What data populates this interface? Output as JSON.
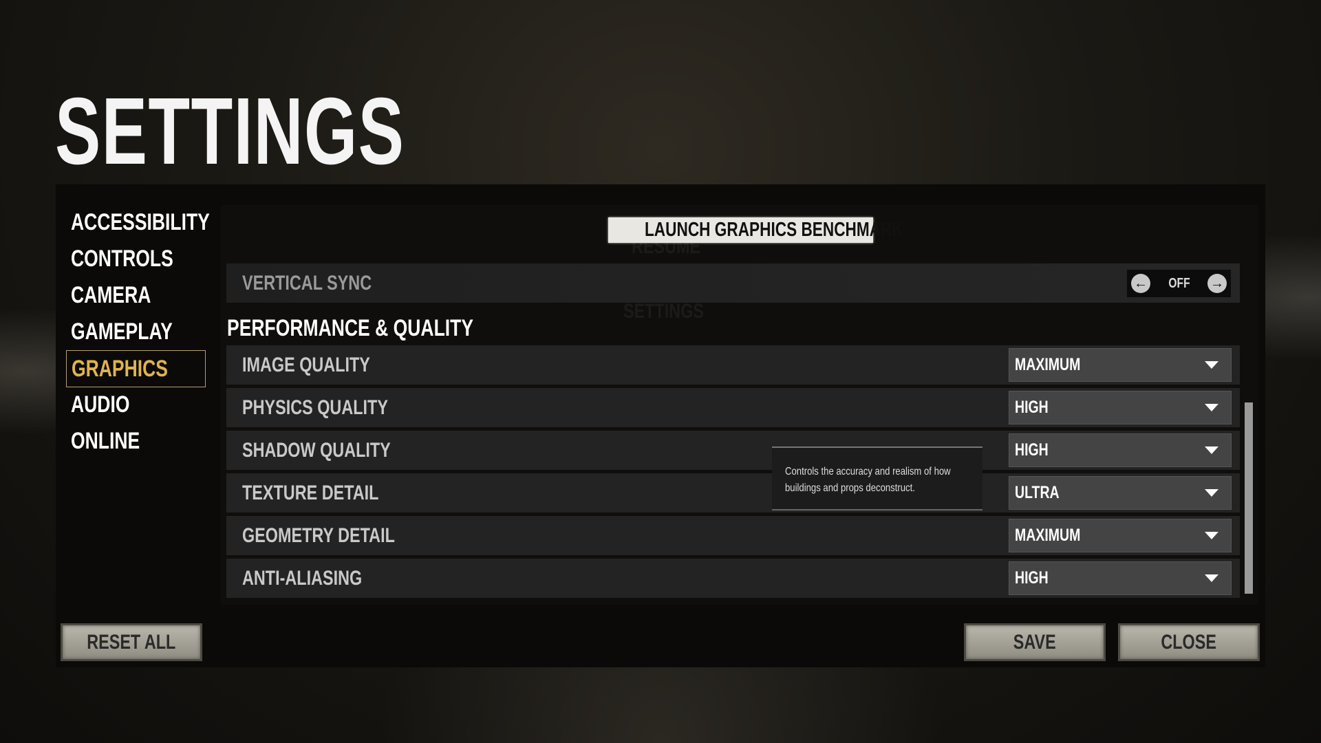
{
  "title": "SETTINGS",
  "sidebar": {
    "items": [
      {
        "label": "ACCESSIBILITY"
      },
      {
        "label": "CONTROLS"
      },
      {
        "label": "CAMERA"
      },
      {
        "label": "GAMEPLAY"
      },
      {
        "label": "GRAPHICS",
        "active": true
      },
      {
        "label": "AUDIO"
      },
      {
        "label": "ONLINE"
      }
    ]
  },
  "ghost": {
    "resume": "RESUME",
    "settings": "SETTINGS"
  },
  "benchmark_label": "LAUNCH GRAPHICS BENCHMARK",
  "vertical_sync": {
    "label": "VERTICAL SYNC",
    "value": "OFF"
  },
  "section_title": "PERFORMANCE & QUALITY",
  "settings": [
    {
      "label": "IMAGE QUALITY",
      "value": "MAXIMUM"
    },
    {
      "label": "PHYSICS QUALITY",
      "value": "HIGH"
    },
    {
      "label": "SHADOW QUALITY",
      "value": "HIGH"
    },
    {
      "label": "TEXTURE DETAIL",
      "value": "ULTRA"
    },
    {
      "label": "GEOMETRY DETAIL",
      "value": "MAXIMUM"
    },
    {
      "label": "ANTI-ALIASING",
      "value": "HIGH"
    }
  ],
  "tooltip": {
    "line1": "Controls the accuracy and realism of how",
    "line2": "buildings and props deconstruct."
  },
  "buttons": {
    "reset": "RESET ALL",
    "save": "SAVE",
    "close": "CLOSE"
  },
  "colors": {
    "accent": "#e0b44a",
    "active_border": "#b9a06a"
  }
}
